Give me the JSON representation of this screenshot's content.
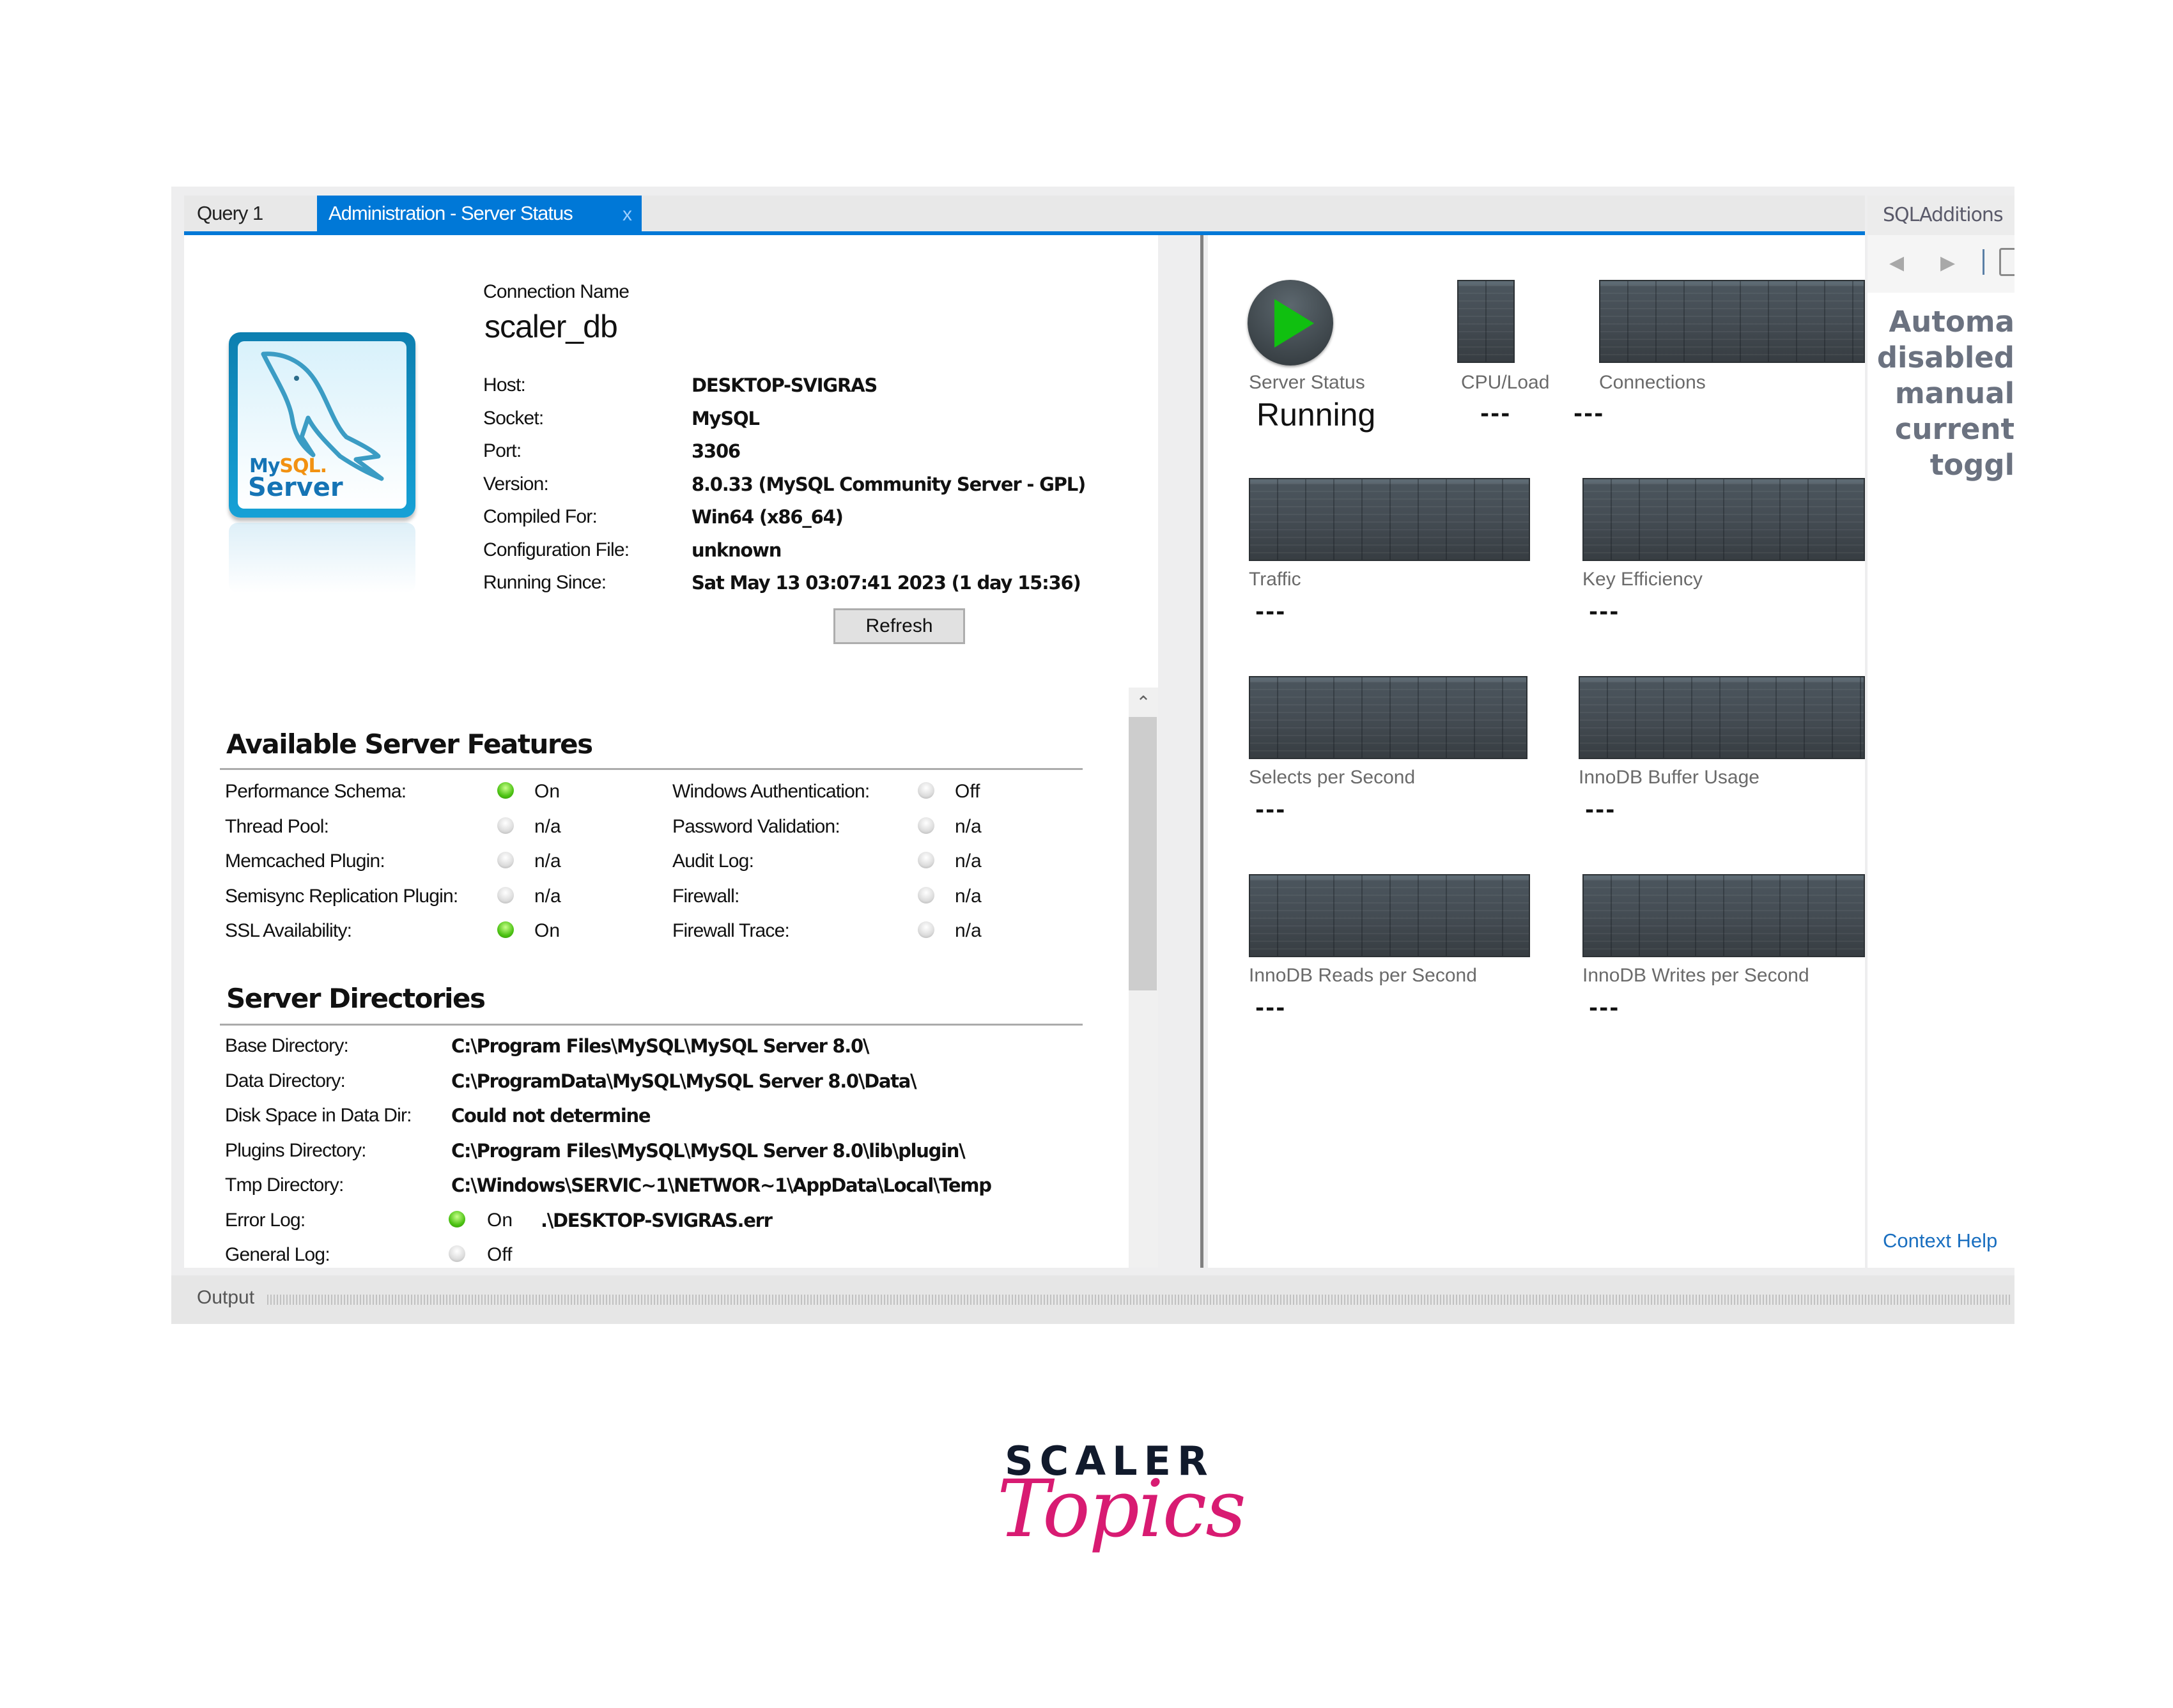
{
  "tabs": [
    {
      "label": "Query 1",
      "active": false
    },
    {
      "label": "Administration - Server Status",
      "active": true,
      "close": "x"
    }
  ],
  "connection": {
    "label": "Connection Name",
    "name": "scaler_db",
    "fields": [
      {
        "label": "Host:",
        "value": "DESKTOP-SVIGRAS"
      },
      {
        "label": "Socket:",
        "value": "MySQL"
      },
      {
        "label": "Port:",
        "value": "3306"
      },
      {
        "label": "Version:",
        "value": "8.0.33 (MySQL Community Server - GPL)"
      },
      {
        "label": "Compiled For:",
        "value": "Win64   (x86_64)"
      },
      {
        "label": "Configuration File:",
        "value": "unknown"
      },
      {
        "label": "Running Since:",
        "value": "Sat May 13 03:07:41 2023 (1 day 15:36)"
      }
    ],
    "refresh_label": "Refresh"
  },
  "logo": {
    "line1a": "My",
    "line1b": "SQL.",
    "line2": "Server",
    "colors": {
      "blue": "#1574b5",
      "orange": "#f29111"
    }
  },
  "features": {
    "title": "Available Server Features",
    "left": [
      {
        "label": "Performance Schema:",
        "state": "on",
        "value": "On"
      },
      {
        "label": "Thread Pool:",
        "state": "off",
        "value": "n/a"
      },
      {
        "label": "Memcached Plugin:",
        "state": "off",
        "value": "n/a"
      },
      {
        "label": "Semisync Replication Plugin:",
        "state": "off",
        "value": "n/a"
      },
      {
        "label": "SSL Availability:",
        "state": "on",
        "value": "On"
      }
    ],
    "right": [
      {
        "label": "Windows Authentication:",
        "state": "off",
        "value": "Off"
      },
      {
        "label": "Password Validation:",
        "state": "off",
        "value": "n/a"
      },
      {
        "label": "Audit Log:",
        "state": "off",
        "value": "n/a"
      },
      {
        "label": "Firewall:",
        "state": "off",
        "value": "n/a"
      },
      {
        "label": "Firewall Trace:",
        "state": "off",
        "value": "n/a"
      }
    ]
  },
  "directories": {
    "title": "Server Directories",
    "items": [
      {
        "label": "Base Directory:",
        "value": "C:\\Program Files\\MySQL\\MySQL Server 8.0\\"
      },
      {
        "label": "Data Directory:",
        "value": "C:\\ProgramData\\MySQL\\MySQL Server 8.0\\Data\\"
      },
      {
        "label": "Disk Space in Data Dir:",
        "value": "Could not determine"
      },
      {
        "label": "Plugins Directory:",
        "value": "C:\\Program Files\\MySQL\\MySQL Server 8.0\\lib\\plugin\\"
      },
      {
        "label": "Tmp Directory:",
        "value": "C:\\Windows\\SERVIC~1\\NETWOR~1\\AppData\\Local\\Temp"
      }
    ],
    "logs": [
      {
        "label": "Error Log:",
        "state": "on",
        "status": "On",
        "value": ".\\DESKTOP-SVIGRAS.err"
      },
      {
        "label": "General Log:",
        "state": "off",
        "status": "Off",
        "value": ""
      }
    ]
  },
  "status": {
    "server_status_label": "Server Status",
    "server_status_value": "Running",
    "cpu_label": "CPU/Load",
    "cpu_value": "---",
    "connections_label": "Connections",
    "connections_value": "---",
    "graphs": [
      {
        "label": "Traffic",
        "value": "---"
      },
      {
        "label": "Key Efficiency",
        "value": "---"
      },
      {
        "label": "Selects per Second",
        "value": "---"
      },
      {
        "label": "InnoDB Buffer Usage",
        "value": "---"
      },
      {
        "label": "InnoDB Reads per Second",
        "value": "---"
      },
      {
        "label": "InnoDB Writes per Second",
        "value": "---"
      }
    ],
    "colors": {
      "play": "#10c010",
      "graph_bg": "#444c53"
    }
  },
  "sidebar": {
    "title": "SQLAdditions",
    "message_lines": [
      "Automa",
      "disabled",
      "manual",
      "current",
      "toggl"
    ],
    "context_help": "Context Help"
  },
  "output": {
    "label": "Output"
  },
  "brand": {
    "top": "SCALER",
    "bottom": "Topics",
    "colors": {
      "top": "#111a2c",
      "bottom": "#d81b72"
    }
  },
  "accent": "#0078d7"
}
